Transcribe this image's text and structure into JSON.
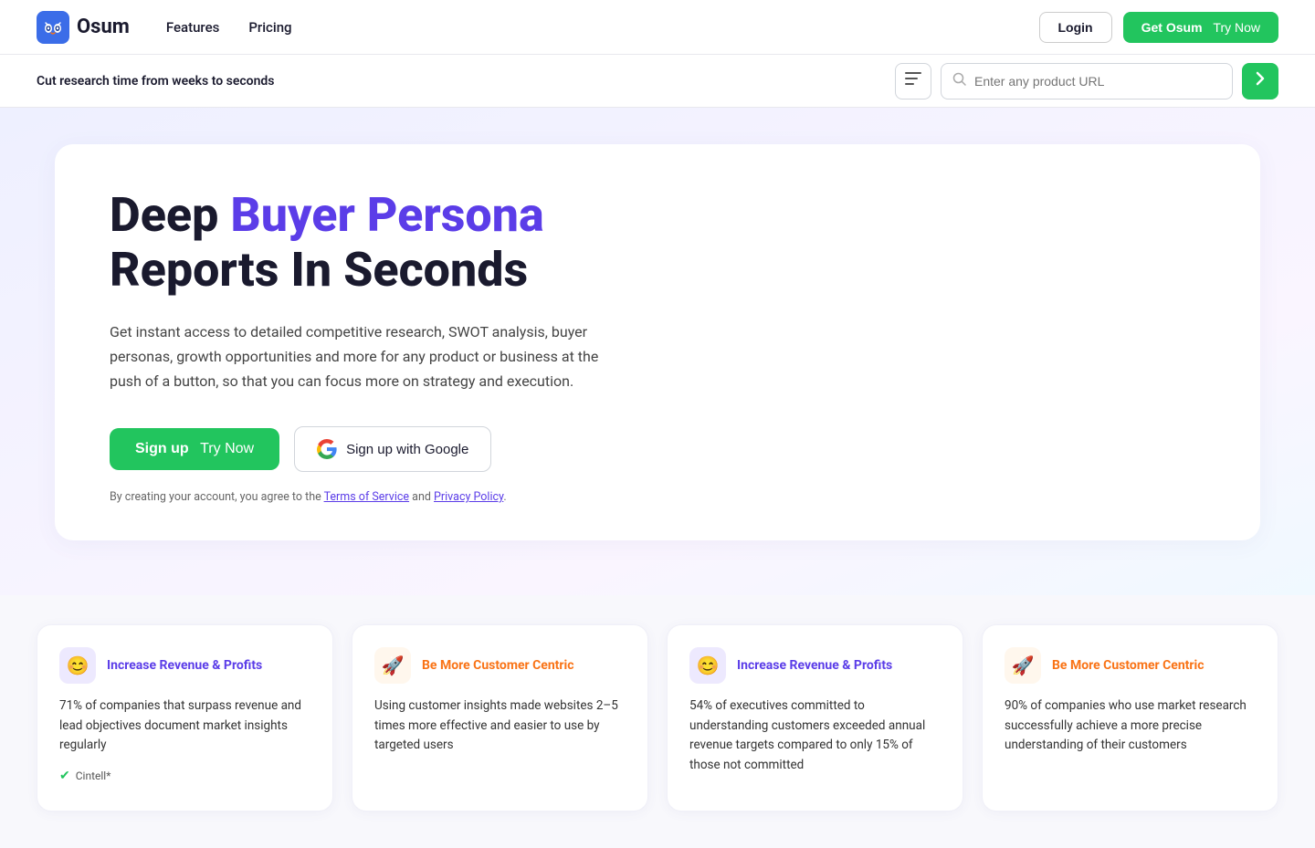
{
  "nav": {
    "logo_text": "Osum",
    "links": [
      {
        "label": "Features",
        "id": "features"
      },
      {
        "label": "Pricing",
        "id": "pricing"
      }
    ],
    "login_label": "Login",
    "get_osum_label": "Get Osum",
    "try_now_label": "Try Now"
  },
  "subbar": {
    "text": "Cut research time from weeks to seconds",
    "search_placeholder": "Enter any product URL",
    "filter_icon": "≡"
  },
  "hero": {
    "title_plain": "Deep ",
    "title_highlight": "Buyer Persona",
    "title_line2": "Reports In Seconds",
    "description": "Get instant access to detailed competitive research, SWOT analysis, buyer personas, growth opportunities and more for any product or business at the push of a button, so that you can focus more on strategy and execution.",
    "btn_signup_label": "Sign up",
    "btn_signup_sub": "Try Now",
    "btn_google_label": "Sign up with Google",
    "terms_text": "By creating your account, you agree to the ",
    "terms_of_service": "Terms of Service",
    "terms_and": " and ",
    "privacy_policy": "Privacy Policy",
    "terms_end": "."
  },
  "features": [
    {
      "icon": "😊",
      "icon_style": "purple",
      "title": "Increase Revenue & Profits",
      "title_color": "purple",
      "body": "71% of companies that surpass revenue and lead objectives document market insights regularly",
      "source": "Cintell*"
    },
    {
      "icon": "🚀",
      "icon_style": "orange",
      "title": "Be More Customer Centric",
      "title_color": "orange",
      "body": "Using customer insights made websites 2–5 times more effective and easier to use by targeted users",
      "source": ""
    },
    {
      "icon": "😊",
      "icon_style": "purple",
      "title": "Increase Revenue & Profits",
      "title_color": "purple",
      "body": "54% of executives committed to understanding customers exceeded annual revenue targets compared to only 15% of those not committed",
      "source": ""
    },
    {
      "icon": "🚀",
      "icon_style": "orange",
      "title": "Be More Customer Centric",
      "title_color": "orange",
      "body": "90% of companies who use market research successfully achieve a more precise understanding of their customers",
      "source": ""
    }
  ]
}
